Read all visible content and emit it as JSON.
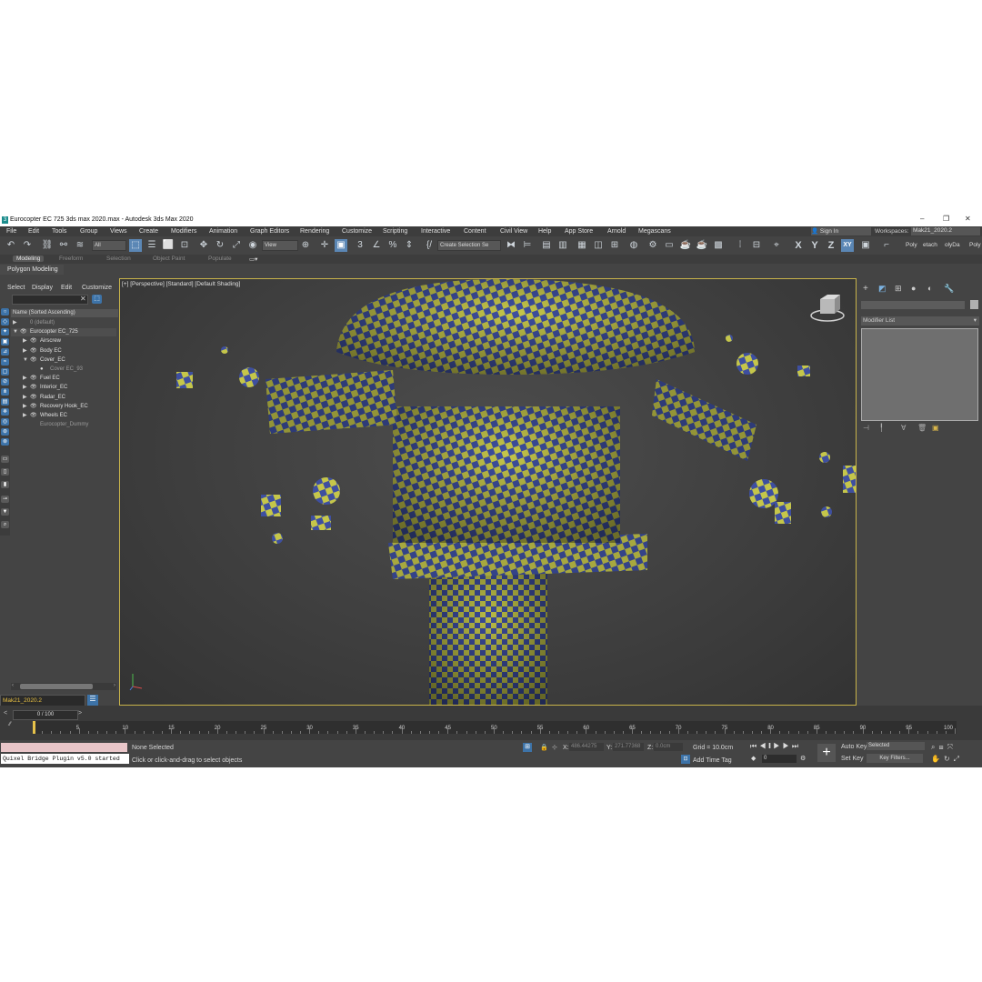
{
  "window": {
    "title": "Eurocopter EC 725 3ds max 2020.max - Autodesk 3ds Max 2020",
    "logo": "3"
  },
  "window_controls": [
    "–",
    "❐",
    "✕"
  ],
  "menu": [
    "File",
    "Edit",
    "Tools",
    "Group",
    "Views",
    "Create",
    "Modifiers",
    "Animation",
    "Graph Editors",
    "Rendering",
    "Customize",
    "Scripting",
    "Interactive",
    "Content",
    "Civil View",
    "Help",
    "App Store",
    "Arnold",
    "Megascans"
  ],
  "account": {
    "sign_in": "Sign In",
    "workspaces_label": "Workspaces:",
    "workspace": "Mak21_2020.2"
  },
  "toolbar": {
    "filter": "All",
    "ref_coord": "View",
    "selection_set": "Create Selection Se",
    "axis_x": "X",
    "axis_y": "Y",
    "axis_z": "Z",
    "axis_xy": "XY",
    "right_items": [
      "Poly",
      "etach",
      "olyDa",
      "Poly"
    ]
  },
  "ribbon": {
    "tabs": [
      "Modeling",
      "Freeform",
      "Selection",
      "Object Paint",
      "Populate"
    ],
    "active": "Modeling",
    "sub": "Polygon Modeling"
  },
  "scene_explorer": {
    "tabs": [
      "Select",
      "Display",
      "Edit",
      "Customize"
    ],
    "sort": "Name (Sorted Ascending)",
    "rows": [
      {
        "label": "0 (default)",
        "depth": 0,
        "arrow": "▶",
        "eye": "",
        "dim": true
      },
      {
        "label": "Eurocopter EC_725",
        "depth": 0,
        "arrow": "▼",
        "eye": "👁",
        "sel": true
      },
      {
        "label": "Airscrew",
        "depth": 1,
        "arrow": "▶",
        "eye": "👁"
      },
      {
        "label": "Body EC",
        "depth": 1,
        "arrow": "▶",
        "eye": "👁"
      },
      {
        "label": "Cover_EC",
        "depth": 1,
        "arrow": "▼",
        "eye": "👁"
      },
      {
        "label": "Cover EC_93",
        "depth": 2,
        "arrow": "",
        "eye": "●",
        "dim": true
      },
      {
        "label": "Fuel EC",
        "depth": 1,
        "arrow": "▶",
        "eye": "👁"
      },
      {
        "label": "Interior_EC",
        "depth": 1,
        "arrow": "▶",
        "eye": "👁"
      },
      {
        "label": "Radar_EC",
        "depth": 1,
        "arrow": "▶",
        "eye": "👁"
      },
      {
        "label": "Recovery Hook_EC",
        "depth": 1,
        "arrow": "▶",
        "eye": "👁"
      },
      {
        "label": "Wheels EC",
        "depth": 1,
        "arrow": "▶",
        "eye": "👁"
      },
      {
        "label": "Eurocopter_Dummy",
        "depth": 1,
        "arrow": "",
        "eye": "",
        "dim": true
      }
    ],
    "layer": "Mak21_2020.2"
  },
  "viewport": {
    "label": "[+] [Perspective] [Standard] [Default Shading]"
  },
  "command_panel": {
    "modifier_list": "Modifier List"
  },
  "timeline": {
    "frame_range": "0 / 100",
    "ticks": [
      "5",
      "10",
      "15",
      "20",
      "25",
      "30",
      "35",
      "40",
      "45",
      "50",
      "55",
      "60",
      "65",
      "70",
      "75",
      "80",
      "85",
      "90",
      "95",
      "100"
    ]
  },
  "status": {
    "selection": "None Selected",
    "prompt": "Click or click-and-drag to select objects",
    "script_output": "Quixel Bridge Plugin v5.0 started",
    "x_label": "X:",
    "x_value": "486.44275",
    "y_label": "Y:",
    "y_value": "271.77368",
    "z_label": "Z:",
    "z_value": "0.0cm",
    "grid": "Grid = 10.0cm",
    "add_time_tag": "Add Time Tag",
    "auto_key": "Auto Key",
    "selected": "Selected",
    "set_key": "Set Key",
    "key_filters": "Key Filters...",
    "frame": "0"
  }
}
